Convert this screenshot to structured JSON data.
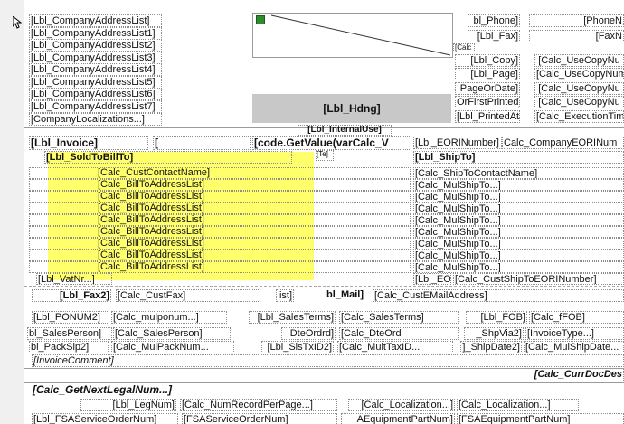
{
  "fields": {
    "lbl_company_address_list": "[Lbl_CompanyAddressList]",
    "lbl_company_address_list1": "[Lbl_CompanyAddressList1]",
    "lbl_company_address_list2": "[Lbl_CompanyAddressList2]",
    "lbl_company_address_list3": "[Lbl_CompanyAddressList3]",
    "lbl_company_address_list4": "[Lbl_CompanyAddressList4]",
    "lbl_company_address_list5": "[Lbl_CompanyAddressList5]",
    "lbl_company_address_list6": "[Lbl_CompanyAddressList6]",
    "lbl_company_address_list7": "[Lbl_CompanyAddressList7]",
    "company_localizations": "[CompanyLocalizations...]",
    "lbl_phone": "bl_Phone]",
    "phone_num": "[PhoneN",
    "lbl_fax": "[Lbl_Fax]",
    "fax_num": "[FaxN",
    "calc_small": "[Calc",
    "lbl_copy": "[Lbl_Copy]",
    "calc_use_copy_1": "[Calc_UseCopyNu",
    "lbl_page": "[Lbl_Page]",
    "calc_use_copy_2": "[Calc_UseCopyNum",
    "page_or_date": "PageOrDate]",
    "calc_use_copy_3": "[Calc_UseCopyNu",
    "or_first_printed": "OrFirstPrinted]",
    "calc_use_copy_4": "[Calc_UseCopyNu",
    "lbl_printed_at": "[Lbl_PrintedAt]",
    "calc_execution_time": "[Calc_ExecutionTim",
    "lbl_hdng": "[Lbl_Hdng]",
    "lbl_internal_use": "[Lbl_InternalUse]",
    "lbl_invoice": "[Lbl_Invoice]",
    "bracket": "[",
    "code_get_value": "[code.GetValue(varCalc_V",
    "lbl_eori_number": "[Lbl_EORINumber]",
    "calc_company_eori": "Calc_CompanyEORINum",
    "lbl_sold_to_bill_to": "[Lbl_SoldToBillTo]",
    "tiny_marker": "[Te]",
    "lbl_ship_to": "[Lbl_ShipTo]",
    "calc_cust_contact_name": "[Calc_CustContactName]",
    "calc_bill_to_address_list": "[Calc_BillToAddressList]",
    "calc_ship_to_contact_name": "[Calc_ShipToContactName]",
    "calc_mul_ship_to": "[Calc_MulShipTo...]",
    "lbl_vat_nr": "[Lbl_VatNr...]",
    "lbl_eo": "[Lbl_EO",
    "calc_cust_ship_to_eori": "[Calc_CustShipToEORINumber]",
    "lbl_fax2": "[Lbl_Fax2]",
    "calc_cust_fax": "[Calc_CustFax]",
    "ist": "ist]",
    "lbl_mail": "bl_Mail]",
    "calc_cust_email": "[Calc_CustEMailAddress]",
    "lbl_ponum2": "[Lbl_PONUM2]",
    "calc_mul_ponum": "[Calc_mulponum...]",
    "lbl_sales_terms": "[Lbl_SalesTerms]",
    "calc_sales_terms": "[Calc_SalesTerms]",
    "lbl_fob": "[Lbl_FOB]",
    "calc_ffob": "[Calc_fFOB]",
    "bl_sales_person": "bl_SalesPerson]",
    "calc_sales_person": "[Calc_SalesPerson]",
    "dte_ordrd": "DteOrdrd]",
    "calc_dte_ord": "[Calc_DteOrd",
    "shp_via2": "_ShpVia2]",
    "invoice_type": "[InvoiceType...]",
    "lbl_pack_slp2": "bl_PackSlp2]",
    "calc_mul_pack_num": "[Calc_MulPackNum...",
    "lbl_sls_tx_id2": "[Lbl_SlsTxID2]",
    "calc_mult_tax_id": "[Calc_MultTaxID...",
    "ship_date2": "]_ShipDate2]",
    "calc_mul_ship_date": "[Calc_MulShipDate...",
    "invoice_comment": "[InvoiceComment]",
    "calc_curr_doc_des": "[Calc_CurrDocDes",
    "calc_get_next_legal_num": "[Calc_GetNextLegalNum...]",
    "lbl_leg_num": "[Lbl_LegNum]",
    "calc_num_record_per_page": "[Calc_NumRecordPerPage...]",
    "calc_localization_1": "[Calc_Localization...]",
    "calc_localization_2": "[Calc_Localization...]",
    "lbl_fsa_service_order_num": "[Lbl_FSAServiceOrderNum]",
    "fsa_service_order_num": "[FSAServiceOrderNum]",
    "a_equipment_part_num": "AEquipmentPartNum]",
    "fsa_equipment_part_num": "[FSAEquipmentPartNum]"
  },
  "icons": {
    "picture": "picture-placeholder-icon",
    "cursor": "mouse-cursor-icon"
  },
  "colors": {
    "highlight": "#ffff33",
    "heading_box": "#c8c8c8"
  }
}
